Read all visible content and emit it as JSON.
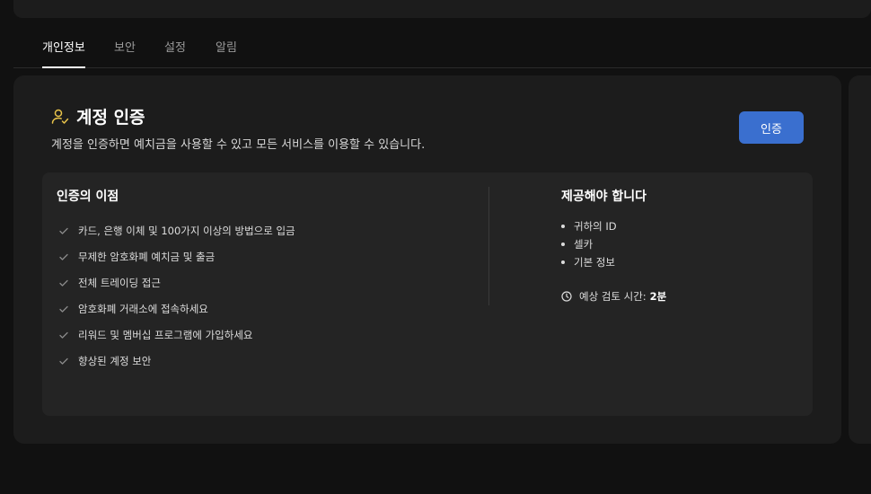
{
  "tabs": [
    {
      "label": "개인정보",
      "active": true
    },
    {
      "label": "보안",
      "active": false
    },
    {
      "label": "설정",
      "active": false
    },
    {
      "label": "알림",
      "active": false
    }
  ],
  "card": {
    "icon": "user-check-icon",
    "title": "계정 인증",
    "subtitle": "계정을 인증하면 예치금을 사용할 수 있고 모든 서비스를 이용할 수 있습니다.",
    "button_label": "인증",
    "accent_color": "#e8c34a",
    "button_color": "#3a6fcf"
  },
  "benefits": {
    "title": "인증의 이점",
    "items": [
      "카드, 은행 이체 및 100가지 이상의 방법으로 입금",
      "무제한 암호화폐 예치금 및 출금",
      "전체 트레이딩 접근",
      "암호화폐 거래소에 접속하세요",
      "리워드 및 멤버십 프로그램에 가입하세요",
      "향상된 계정 보안"
    ]
  },
  "requirements": {
    "title": "제공해야 합니다",
    "items": [
      "귀하의 ID",
      "셀카",
      "기본 정보"
    ],
    "estimate_label": "예상 검토 시간:",
    "estimate_value": "2분"
  }
}
